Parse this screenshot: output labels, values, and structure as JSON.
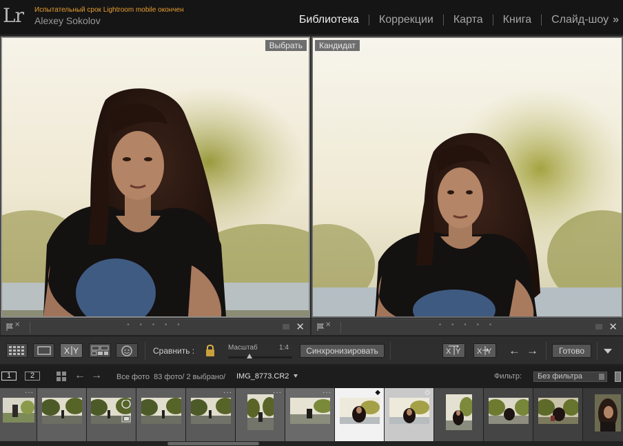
{
  "app": {
    "logo": "Lr",
    "trial_message": "Испытательный срок Lightroom mobile окончен",
    "user_name": "Alexey Sokolov"
  },
  "modules": [
    {
      "label": "Библиотека",
      "active": true
    },
    {
      "label": "Коррекции",
      "active": false
    },
    {
      "label": "Карта",
      "active": false
    },
    {
      "label": "Книга",
      "active": false
    },
    {
      "label": "Слайд-шоу",
      "active": false
    }
  ],
  "more_icon": "»",
  "compare": {
    "select_label": "Выбрать",
    "candidate_label": "Кандидат"
  },
  "toolbar": {
    "compare_label": "Сравнить :",
    "zoom_label": "Масштаб",
    "zoom_value": "1:4",
    "sync_label": "Синхронизировать",
    "done_label": "Готово"
  },
  "film_header": {
    "screen1": "1",
    "screen2": "2",
    "source": "Все фото",
    "counts": "83 фото/ 2 выбрано/",
    "filename": "IMG_8773.CR2",
    "filter_label": "Фильтр:",
    "filter_value": "Без фильтра"
  },
  "icons": {
    "close": "✕",
    "reject": "✕",
    "arrow_left": "←",
    "arrow_right": "→",
    "nav_back": "←",
    "nav_forward": "→"
  }
}
